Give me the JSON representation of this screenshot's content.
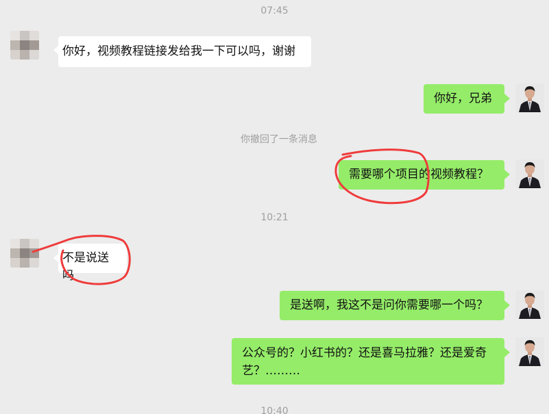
{
  "timestamps": [
    "07:45",
    "10:21",
    "10:40"
  ],
  "system_notice": "你撤回了一条消息",
  "messages": [
    {
      "side": "in",
      "text": "你好，视频教程链接发给我一下可以吗，谢谢"
    },
    {
      "side": "out",
      "text": "你好，兄弟"
    },
    {
      "side": "out",
      "text": "需要哪个项目的视频教程？"
    },
    {
      "side": "in",
      "text": "不是说送吗"
    },
    {
      "side": "out",
      "text": "是送啊，我这不是问你需要哪一个吗？"
    },
    {
      "side": "out",
      "line1": "公众号的？小红书的？还是喜马拉雅？还是爱奇",
      "line2": "艺？………"
    }
  ],
  "colors": {
    "background": "#ececec",
    "incoming_bubble": "#ffffff",
    "outgoing_bubble": "#95ec69",
    "annotation": "#ef3b3b"
  }
}
